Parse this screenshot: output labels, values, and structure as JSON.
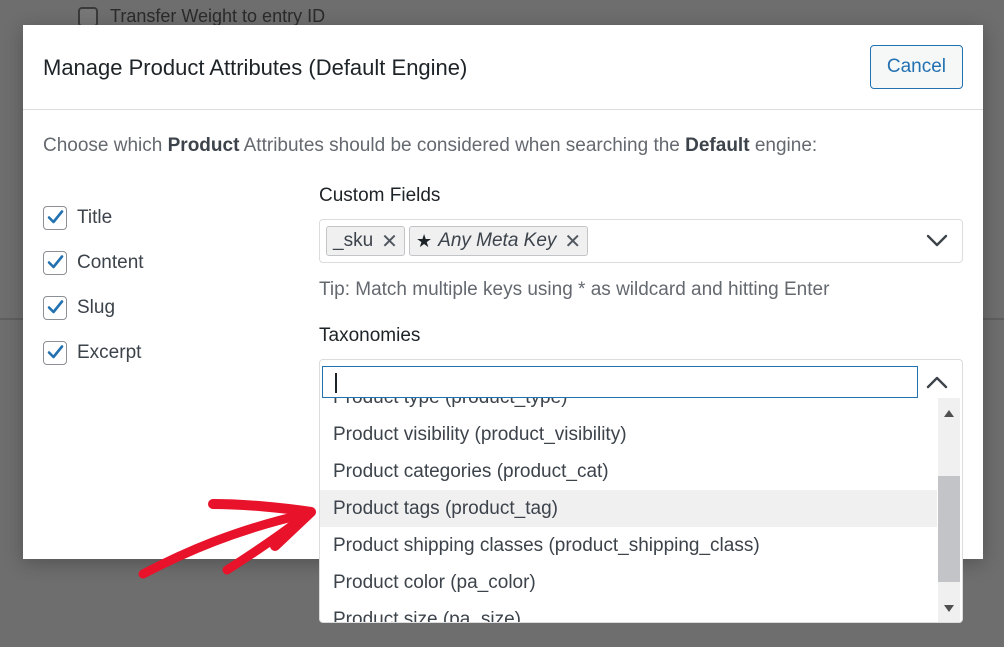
{
  "background": {
    "row_label": "Transfer Weight to entry ID"
  },
  "modal": {
    "title": "Manage Product Attributes (Default Engine)",
    "cancel_label": "Cancel",
    "intro": {
      "part1": "Choose which ",
      "bold1": "Product",
      "part2": " Attributes should be considered when searching the ",
      "bold2": "Default",
      "part3": " engine:"
    }
  },
  "attributes": [
    {
      "label": "Title",
      "checked": true
    },
    {
      "label": "Content",
      "checked": true
    },
    {
      "label": "Slug",
      "checked": true
    },
    {
      "label": "Excerpt",
      "checked": true
    }
  ],
  "custom_fields": {
    "label": "Custom Fields",
    "chips": [
      {
        "label": "_sku",
        "icon": "none"
      },
      {
        "label": "Any Meta Key",
        "icon": "star-icon"
      }
    ],
    "remove_glyph": "✕",
    "tip": "Tip: Match multiple keys using * as wildcard and hitting Enter"
  },
  "taxonomies": {
    "label": "Taxonomies",
    "input_value": "",
    "options": [
      "Product type (product_type)",
      "Product visibility (product_visibility)",
      "Product categories (product_cat)",
      "Product tags (product_tag)",
      "Product shipping classes (product_shipping_class)",
      "Product color (pa_color)",
      "Product size (pa_size)"
    ],
    "highlighted_option": "Product tags (product_tag)",
    "scroll_position": 0.45
  },
  "colors": {
    "accent": "#2271b1",
    "annotation_arrow": "#e8132b"
  }
}
